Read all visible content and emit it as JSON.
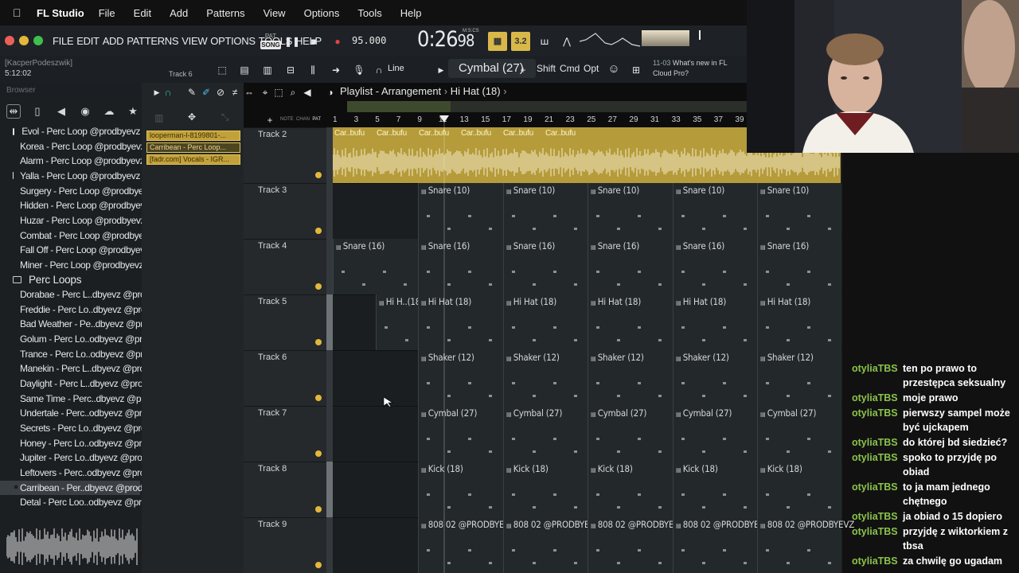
{
  "menubar": {
    "app_name": "FL Studio",
    "items": [
      "File",
      "Edit",
      "Add",
      "Patterns",
      "View",
      "Options",
      "Tools",
      "Help"
    ]
  },
  "fl_menu": [
    "FILE",
    "EDIT",
    "ADD",
    "PATTERNS",
    "VIEW",
    "OPTIONS",
    "TOOLS",
    "HELP"
  ],
  "transport": {
    "pat_label": "PAT",
    "song_label": "SONG",
    "tempo": "95.000",
    "time_main": "0:26",
    "time_sub": "98",
    "time_units": "M:S:CS",
    "ybtn2": "3.2"
  },
  "row2": {
    "user": "[KacperPodeszwik]",
    "clock": "5:12:02",
    "current_track": "Track 6",
    "snap": "Line",
    "selected_pattern": "Cymbal (27)",
    "keys": [
      "Shift",
      "Cmd",
      "Opt"
    ],
    "news_date": "11-03",
    "news_text": "What's new in FL Cloud Pro?"
  },
  "browser": {
    "title": "Browser",
    "items": [
      {
        "label": "Evol - Perc Loop @prodbyevz",
        "type": "file"
      },
      {
        "label": "Korea - Perc Loop @prodbyevz",
        "type": "file"
      },
      {
        "label": "Alarm - Perc Loop @prodbyevz",
        "type": "file"
      },
      {
        "label": "Yalla - Perc Loop @prodbyevz",
        "type": "file"
      },
      {
        "label": "Surgery - Perc Loop @prodbyevz",
        "type": "file"
      },
      {
        "label": "Hidden - Perc Loop @prodbyevz",
        "type": "file"
      },
      {
        "label": "Huzar - Perc Loop @prodbyevz",
        "type": "file"
      },
      {
        "label": "Combat - Perc Loop @prodbyevz",
        "type": "file"
      },
      {
        "label": "Fall Off - Perc Loop @prodbyevz",
        "type": "file"
      },
      {
        "label": "Miner - Perc Loop @prodbyevz",
        "type": "file"
      },
      {
        "label": "Perc Loops",
        "type": "folder"
      },
      {
        "label": "Dorabae - Perc L..dbyevz @prodbufu",
        "type": "file"
      },
      {
        "label": "Freddie - Perc Lo..dbyevz @prodbufu",
        "type": "file"
      },
      {
        "label": "Bad Weather - Pe..dbyevz @prodbufu",
        "type": "file"
      },
      {
        "label": "Golum - Perc Lo..odbyevz @prodbufu",
        "type": "file"
      },
      {
        "label": "Trance - Perc Lo..odbyevz @prodbufu",
        "type": "file"
      },
      {
        "label": "Manekin - Perc L..dbyevz @prodbufu",
        "type": "file"
      },
      {
        "label": "Daylight - Perc L..dbyevz @prodbufu",
        "type": "file"
      },
      {
        "label": "Same Time - Perc..dbyevz @prodbufu",
        "type": "file"
      },
      {
        "label": "Undertale - Perc..odbyevz @prodbufu",
        "type": "file"
      },
      {
        "label": "Secrets - Perc Lo..dbyevz @prodbufu",
        "type": "file"
      },
      {
        "label": "Honey - Perc Lo..odbyevz @prodbufu",
        "type": "file"
      },
      {
        "label": "Jupiter - Perc Lo..dbyevz @prodbufu",
        "type": "file"
      },
      {
        "label": "Leftovers - Perc..odbyevz @prodbufu",
        "type": "file"
      },
      {
        "label": "Carribean - Per..dbyevz @prodbufu",
        "type": "file",
        "selected": true
      },
      {
        "label": "Detal - Perc Loo..odbyevz @prodbufu",
        "type": "file"
      }
    ]
  },
  "picker": {
    "clips": [
      "looperman-l-8199801-...",
      "Carribean - Perc Loop...",
      "[fadr.com] Vocals - IGR..."
    ]
  },
  "playlist": {
    "title": "Playlist - Arrangement",
    "pattern": "Hi Hat (18)",
    "ruler": [
      "1",
      "3",
      "5",
      "7",
      "9",
      "11",
      "13",
      "15",
      "17",
      "19",
      "21",
      "23",
      "25",
      "27",
      "29",
      "31",
      "33",
      "35",
      "37",
      "39"
    ],
    "audio_label": "Car..bufu",
    "tracks": [
      {
        "name": "Track 2",
        "clips": []
      },
      {
        "name": "Track 3",
        "clips": [
          "Snare (10)",
          "Snare (10)",
          "Snare (10)",
          "Snare (10)",
          "Snare (10)"
        ]
      },
      {
        "name": "Track 4",
        "clips": [
          "Snare (16)",
          "Snare (16)",
          "Snare (16)",
          "Snare (16)",
          "Snare (16)",
          "Snare (16)"
        ]
      },
      {
        "name": "Track 5",
        "clips": [
          "Hi H..(18)",
          "Hi Hat (18)",
          "Hi Hat (18)",
          "Hi Hat (18)",
          "Hi Hat (18)",
          "Hi Hat (18)"
        ]
      },
      {
        "name": "Track 6",
        "clips": [
          "Shaker (12)",
          "Shaker (12)",
          "Shaker (12)",
          "Shaker (12)",
          "Shaker (12)"
        ]
      },
      {
        "name": "Track 7",
        "clips": [
          "Cymbal (27)",
          "Cymbal (27)",
          "Cymbal (27)",
          "Cymbal (27)",
          "Cymbal (27)"
        ]
      },
      {
        "name": "Track 8",
        "clips": [
          "Kick (18)",
          "Kick (18)",
          "Kick (18)",
          "Kick (18)",
          "Kick (18)"
        ]
      },
      {
        "name": "Track 9",
        "clips": [
          "808 02 @PRODBYEVZ",
          "808 02 @PRODBYEVZ",
          "808 02 @PRODBYEVZ",
          "808 02 @PRODBYEVZ",
          "808 02 @PRODBYEVZ"
        ]
      }
    ]
  },
  "chat": [
    {
      "user": "otyliaTBS",
      "text": "ten po prawo to przestępca seksualny"
    },
    {
      "user": "otyliaTBS",
      "text": "moje prawo"
    },
    {
      "user": "otyliaTBS",
      "text": "pierwszy sampel może być ujckapem"
    },
    {
      "user": "otyliaTBS",
      "text": "do której bd siedzieć?"
    },
    {
      "user": "otyliaTBS",
      "text": "spoko to przyjdę po obiad"
    },
    {
      "user": "otyliaTBS",
      "text": "to ja mam jednego chętnego"
    },
    {
      "user": "otyliaTBS",
      "text": "ja obiad o 15 dopiero"
    },
    {
      "user": "otyliaTBS",
      "text": "przyjdę z wiktorkiem z tbsa"
    },
    {
      "user": "otyliaTBS",
      "text": "za chwilę go ugadam"
    }
  ],
  "colors": {
    "accent_yellow": "#d9b84a",
    "chat_user": "#8bc34a",
    "track_dot": "#e3b73c"
  }
}
